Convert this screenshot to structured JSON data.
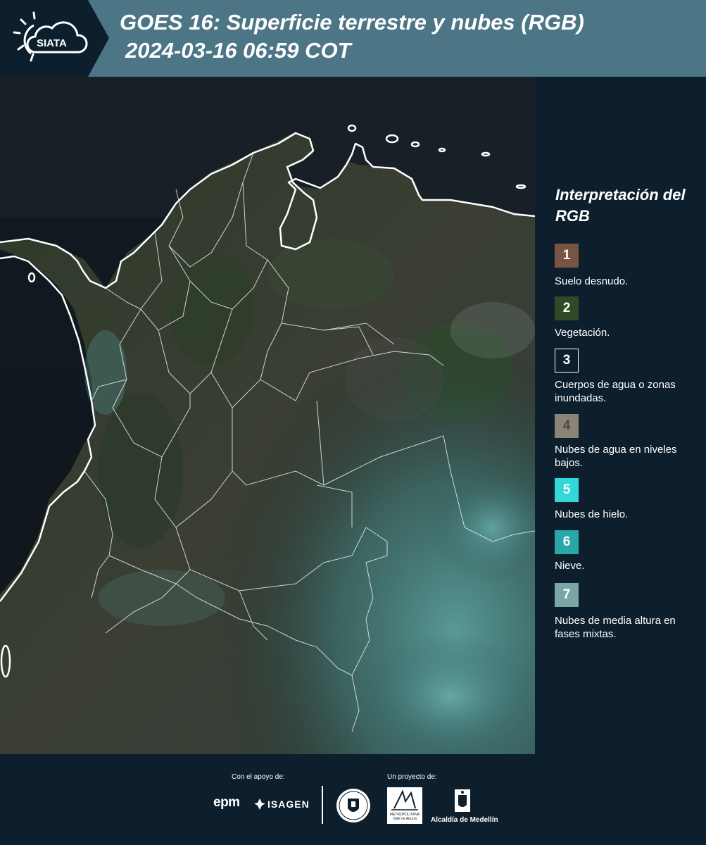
{
  "header": {
    "logo_text": "SIATA",
    "title_line1": "GOES 16: Superficie terrestre y nubes (RGB)",
    "title_line2": "2024-03-16 06:59 COT",
    "band_color": "#4c7585"
  },
  "legend": {
    "title": "Interpretación del RGB",
    "items": [
      {
        "number": "1",
        "label": "Suelo desnudo.",
        "color": "#7a5443"
      },
      {
        "number": "2",
        "label": "Vegetación.",
        "color": "#2f4a24"
      },
      {
        "number": "3",
        "label": "Cuerpos de agua o zonas inundadas.",
        "color": "#0d1f2d"
      },
      {
        "number": "4",
        "label": "Nubes de agua en niveles bajos.",
        "color": "#8a8378"
      },
      {
        "number": "5",
        "label": "Nubes de hielo.",
        "color": "#34d7d7"
      },
      {
        "number": "6",
        "label": "Nieve.",
        "color": "#2aa7a7"
      },
      {
        "number": "7",
        "label": "Nubes de media altura en fases mixtas.",
        "color": "#7ba6a6"
      }
    ]
  },
  "footer": {
    "support_caption": "Con el apoyo de:",
    "project_caption": "Un proyecto de:",
    "sponsors": [
      "epm",
      "ISAGEN"
    ],
    "area_logo_text": "METROPOLITANA Valle de Aburrá",
    "alcaldia_text": "Alcaldía de Medellín"
  }
}
